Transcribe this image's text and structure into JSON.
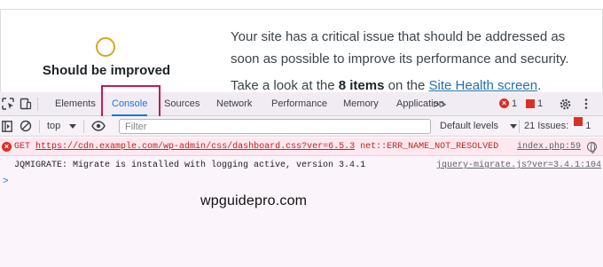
{
  "widget": {
    "status_label": "Should be improved",
    "status_color": "#dba617",
    "message": "Your site has a critical issue that should be addressed as soon as possible to improve its performance and security.",
    "more_prefix": "Take a look at the ",
    "more_count": "8 items",
    "more_middle": " on the ",
    "more_link": "Site Health screen",
    "more_suffix": "."
  },
  "devtools": {
    "tabs": [
      {
        "label": "Elements"
      },
      {
        "label": "Console",
        "active": true
      },
      {
        "label": "Sources"
      },
      {
        "label": "Network"
      },
      {
        "label": "Performance"
      },
      {
        "label": "Memory"
      },
      {
        "label": "Application"
      }
    ],
    "more_tabs": ">>",
    "error_count": "1",
    "issue_count": "1",
    "highlight_color": "#c2185b"
  },
  "toolbar": {
    "context": "top",
    "filter_placeholder": "Filter",
    "levels": "Default levels",
    "issues_label": "21 Issues:",
    "issues_count": "1"
  },
  "console": {
    "messages": [
      {
        "level": "error",
        "method": "GET",
        "url": "https://cdn.example.com/wp-admin/css/dashboard.css?ver=6.5.3",
        "detail": "net::ERR_NAME_NOT_RESOLVED",
        "source": "index.php:59"
      },
      {
        "level": "info",
        "text": "JQMIGRATE: Migrate is installed with logging active, version 3.4.1",
        "source": "jquery-migrate.js?ver=3.4.1:104"
      }
    ],
    "prompt": ">"
  },
  "watermark": "wpguidepro.com"
}
